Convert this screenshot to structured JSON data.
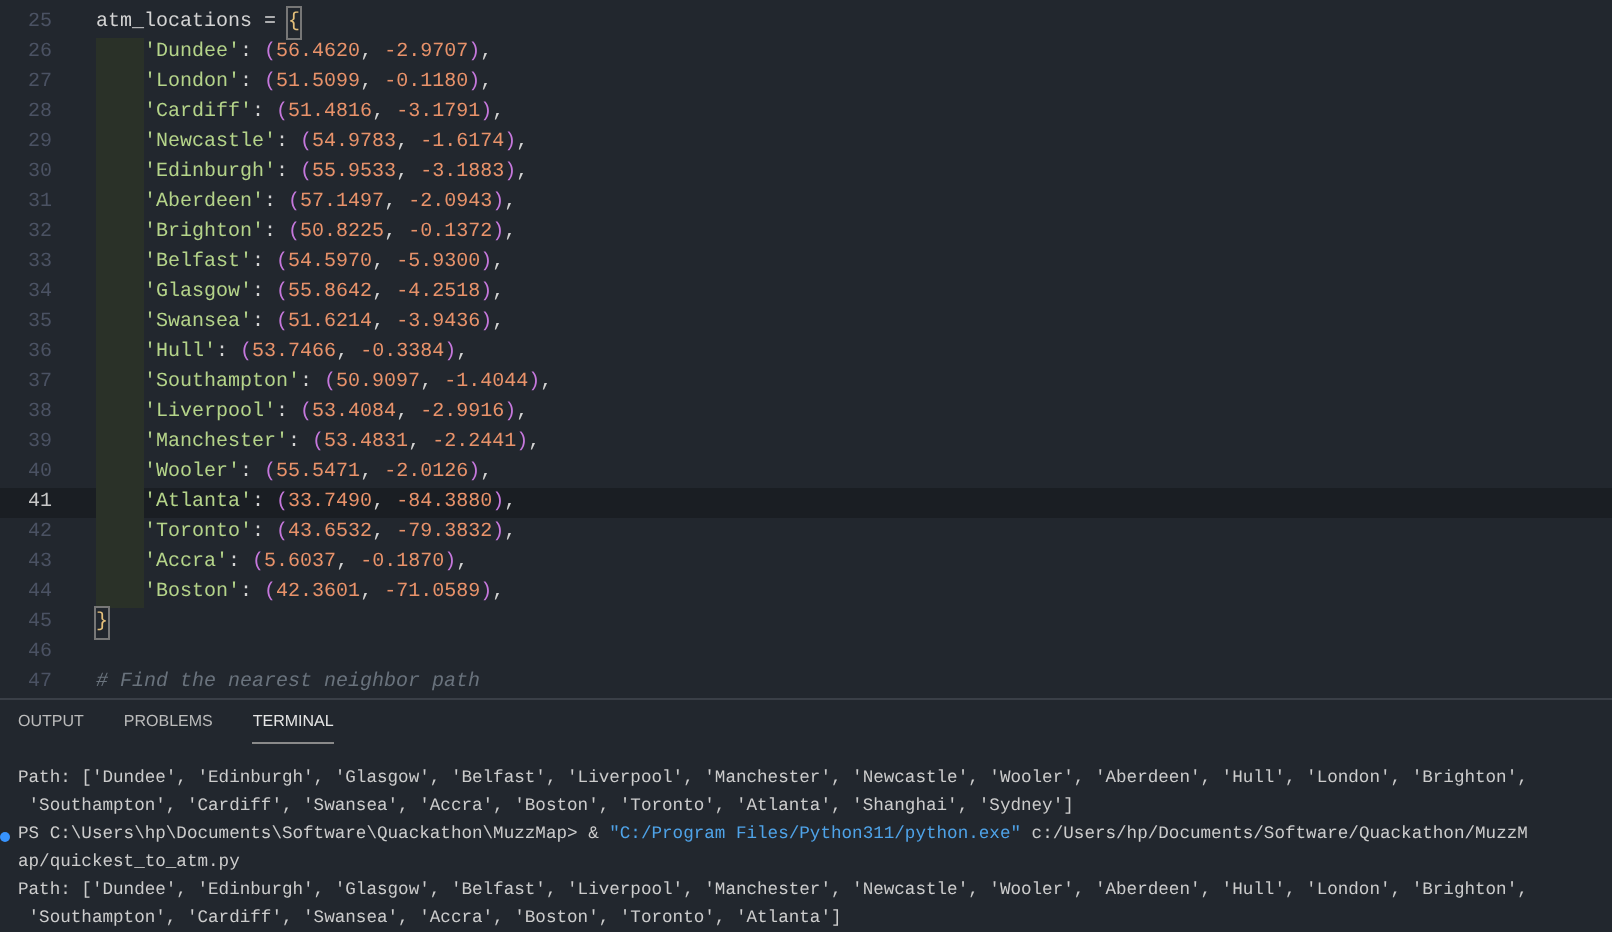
{
  "editor": {
    "lines": [
      {
        "number": "25",
        "kind": "code",
        "current": false,
        "tokens": [
          {
            "kind": "plain",
            "text": "atm_locations = "
          },
          {
            "kind": "brace",
            "text": "{"
          }
        ]
      },
      {
        "number": "26",
        "kind": "entry",
        "current": false,
        "tokens": [
          {
            "kind": "string",
            "text": "'Dundee'"
          },
          {
            "kind": "plain",
            "text": ": "
          },
          {
            "kind": "paren",
            "text": "("
          },
          {
            "kind": "number",
            "text": "56.4620"
          },
          {
            "kind": "plain",
            "text": ", "
          },
          {
            "kind": "number",
            "text": "-2.9707"
          },
          {
            "kind": "paren",
            "text": ")"
          },
          {
            "kind": "plain",
            "text": ","
          }
        ]
      },
      {
        "number": "27",
        "kind": "entry",
        "current": false,
        "tokens": [
          {
            "kind": "string",
            "text": "'London'"
          },
          {
            "kind": "plain",
            "text": ": "
          },
          {
            "kind": "paren",
            "text": "("
          },
          {
            "kind": "number",
            "text": "51.5099"
          },
          {
            "kind": "plain",
            "text": ", "
          },
          {
            "kind": "number",
            "text": "-0.1180"
          },
          {
            "kind": "paren",
            "text": ")"
          },
          {
            "kind": "plain",
            "text": ","
          }
        ]
      },
      {
        "number": "28",
        "kind": "entry",
        "current": false,
        "tokens": [
          {
            "kind": "string",
            "text": "'Cardiff'"
          },
          {
            "kind": "plain",
            "text": ": "
          },
          {
            "kind": "paren",
            "text": "("
          },
          {
            "kind": "number",
            "text": "51.4816"
          },
          {
            "kind": "plain",
            "text": ", "
          },
          {
            "kind": "number",
            "text": "-3.1791"
          },
          {
            "kind": "paren",
            "text": ")"
          },
          {
            "kind": "plain",
            "text": ","
          }
        ]
      },
      {
        "number": "29",
        "kind": "entry",
        "current": false,
        "tokens": [
          {
            "kind": "string",
            "text": "'Newcastle'"
          },
          {
            "kind": "plain",
            "text": ": "
          },
          {
            "kind": "paren",
            "text": "("
          },
          {
            "kind": "number",
            "text": "54.9783"
          },
          {
            "kind": "plain",
            "text": ", "
          },
          {
            "kind": "number",
            "text": "-1.6174"
          },
          {
            "kind": "paren",
            "text": ")"
          },
          {
            "kind": "plain",
            "text": ","
          }
        ]
      },
      {
        "number": "30",
        "kind": "entry",
        "current": false,
        "tokens": [
          {
            "kind": "string",
            "text": "'Edinburgh'"
          },
          {
            "kind": "plain",
            "text": ": "
          },
          {
            "kind": "paren",
            "text": "("
          },
          {
            "kind": "number",
            "text": "55.9533"
          },
          {
            "kind": "plain",
            "text": ", "
          },
          {
            "kind": "number",
            "text": "-3.1883"
          },
          {
            "kind": "paren",
            "text": ")"
          },
          {
            "kind": "plain",
            "text": ","
          }
        ]
      },
      {
        "number": "31",
        "kind": "entry",
        "current": false,
        "tokens": [
          {
            "kind": "string",
            "text": "'Aberdeen'"
          },
          {
            "kind": "plain",
            "text": ": "
          },
          {
            "kind": "paren",
            "text": "("
          },
          {
            "kind": "number",
            "text": "57.1497"
          },
          {
            "kind": "plain",
            "text": ", "
          },
          {
            "kind": "number",
            "text": "-2.0943"
          },
          {
            "kind": "paren",
            "text": ")"
          },
          {
            "kind": "plain",
            "text": ","
          }
        ]
      },
      {
        "number": "32",
        "kind": "entry",
        "current": false,
        "tokens": [
          {
            "kind": "string",
            "text": "'Brighton'"
          },
          {
            "kind": "plain",
            "text": ": "
          },
          {
            "kind": "paren",
            "text": "("
          },
          {
            "kind": "number",
            "text": "50.8225"
          },
          {
            "kind": "plain",
            "text": ", "
          },
          {
            "kind": "number",
            "text": "-0.1372"
          },
          {
            "kind": "paren",
            "text": ")"
          },
          {
            "kind": "plain",
            "text": ","
          }
        ]
      },
      {
        "number": "33",
        "kind": "entry",
        "current": false,
        "tokens": [
          {
            "kind": "string",
            "text": "'Belfast'"
          },
          {
            "kind": "plain",
            "text": ": "
          },
          {
            "kind": "paren",
            "text": "("
          },
          {
            "kind": "number",
            "text": "54.5970"
          },
          {
            "kind": "plain",
            "text": ", "
          },
          {
            "kind": "number",
            "text": "-5.9300"
          },
          {
            "kind": "paren",
            "text": ")"
          },
          {
            "kind": "plain",
            "text": ","
          }
        ]
      },
      {
        "number": "34",
        "kind": "entry",
        "current": false,
        "tokens": [
          {
            "kind": "string",
            "text": "'Glasgow'"
          },
          {
            "kind": "plain",
            "text": ": "
          },
          {
            "kind": "paren",
            "text": "("
          },
          {
            "kind": "number",
            "text": "55.8642"
          },
          {
            "kind": "plain",
            "text": ", "
          },
          {
            "kind": "number",
            "text": "-4.2518"
          },
          {
            "kind": "paren",
            "text": ")"
          },
          {
            "kind": "plain",
            "text": ","
          }
        ]
      },
      {
        "number": "35",
        "kind": "entry",
        "current": false,
        "tokens": [
          {
            "kind": "string",
            "text": "'Swansea'"
          },
          {
            "kind": "plain",
            "text": ": "
          },
          {
            "kind": "paren",
            "text": "("
          },
          {
            "kind": "number",
            "text": "51.6214"
          },
          {
            "kind": "plain",
            "text": ", "
          },
          {
            "kind": "number",
            "text": "-3.9436"
          },
          {
            "kind": "paren",
            "text": ")"
          },
          {
            "kind": "plain",
            "text": ","
          }
        ]
      },
      {
        "number": "36",
        "kind": "entry",
        "current": false,
        "tokens": [
          {
            "kind": "string",
            "text": "'Hull'"
          },
          {
            "kind": "plain",
            "text": ": "
          },
          {
            "kind": "paren",
            "text": "("
          },
          {
            "kind": "number",
            "text": "53.7466"
          },
          {
            "kind": "plain",
            "text": ", "
          },
          {
            "kind": "number",
            "text": "-0.3384"
          },
          {
            "kind": "paren",
            "text": ")"
          },
          {
            "kind": "plain",
            "text": ","
          }
        ]
      },
      {
        "number": "37",
        "kind": "entry",
        "current": false,
        "tokens": [
          {
            "kind": "string",
            "text": "'Southampton'"
          },
          {
            "kind": "plain",
            "text": ": "
          },
          {
            "kind": "paren",
            "text": "("
          },
          {
            "kind": "number",
            "text": "50.9097"
          },
          {
            "kind": "plain",
            "text": ", "
          },
          {
            "kind": "number",
            "text": "-1.4044"
          },
          {
            "kind": "paren",
            "text": ")"
          },
          {
            "kind": "plain",
            "text": ","
          }
        ]
      },
      {
        "number": "38",
        "kind": "entry",
        "current": false,
        "tokens": [
          {
            "kind": "string",
            "text": "'Liverpool'"
          },
          {
            "kind": "plain",
            "text": ": "
          },
          {
            "kind": "paren",
            "text": "("
          },
          {
            "kind": "number",
            "text": "53.4084"
          },
          {
            "kind": "plain",
            "text": ", "
          },
          {
            "kind": "number",
            "text": "-2.9916"
          },
          {
            "kind": "paren",
            "text": ")"
          },
          {
            "kind": "plain",
            "text": ","
          }
        ]
      },
      {
        "number": "39",
        "kind": "entry",
        "current": false,
        "tokens": [
          {
            "kind": "string",
            "text": "'Manchester'"
          },
          {
            "kind": "plain",
            "text": ": "
          },
          {
            "kind": "paren",
            "text": "("
          },
          {
            "kind": "number",
            "text": "53.4831"
          },
          {
            "kind": "plain",
            "text": ", "
          },
          {
            "kind": "number",
            "text": "-2.2441"
          },
          {
            "kind": "paren",
            "text": ")"
          },
          {
            "kind": "plain",
            "text": ","
          }
        ]
      },
      {
        "number": "40",
        "kind": "entry",
        "current": false,
        "tokens": [
          {
            "kind": "string",
            "text": "'Wooler'"
          },
          {
            "kind": "plain",
            "text": ": "
          },
          {
            "kind": "paren",
            "text": "("
          },
          {
            "kind": "number",
            "text": "55.5471"
          },
          {
            "kind": "plain",
            "text": ", "
          },
          {
            "kind": "number",
            "text": "-2.0126"
          },
          {
            "kind": "paren",
            "text": ")"
          },
          {
            "kind": "plain",
            "text": ","
          }
        ]
      },
      {
        "number": "41",
        "kind": "entry",
        "current": true,
        "tokens": [
          {
            "kind": "string",
            "text": "'Atlanta'"
          },
          {
            "kind": "plain",
            "text": ": "
          },
          {
            "kind": "paren",
            "text": "("
          },
          {
            "kind": "number",
            "text": "33.7490"
          },
          {
            "kind": "plain",
            "text": ", "
          },
          {
            "kind": "number",
            "text": "-84.3880"
          },
          {
            "kind": "paren",
            "text": ")"
          },
          {
            "kind": "plain",
            "text": ","
          }
        ]
      },
      {
        "number": "42",
        "kind": "entry",
        "current": false,
        "tokens": [
          {
            "kind": "string",
            "text": "'Toronto'"
          },
          {
            "kind": "plain",
            "text": ": "
          },
          {
            "kind": "paren",
            "text": "("
          },
          {
            "kind": "number",
            "text": "43.6532"
          },
          {
            "kind": "plain",
            "text": ", "
          },
          {
            "kind": "number",
            "text": "-79.3832"
          },
          {
            "kind": "paren",
            "text": ")"
          },
          {
            "kind": "plain",
            "text": ","
          }
        ]
      },
      {
        "number": "43",
        "kind": "entry",
        "current": false,
        "tokens": [
          {
            "kind": "string",
            "text": "'Accra'"
          },
          {
            "kind": "plain",
            "text": ": "
          },
          {
            "kind": "paren",
            "text": "("
          },
          {
            "kind": "number",
            "text": "5.6037"
          },
          {
            "kind": "plain",
            "text": ", "
          },
          {
            "kind": "number",
            "text": "-0.1870"
          },
          {
            "kind": "paren",
            "text": ")"
          },
          {
            "kind": "plain",
            "text": ","
          }
        ]
      },
      {
        "number": "44",
        "kind": "entry",
        "current": false,
        "tokens": [
          {
            "kind": "string",
            "text": "'Boston'"
          },
          {
            "kind": "plain",
            "text": ": "
          },
          {
            "kind": "paren",
            "text": "("
          },
          {
            "kind": "number",
            "text": "42.3601"
          },
          {
            "kind": "plain",
            "text": ", "
          },
          {
            "kind": "number",
            "text": "-71.0589"
          },
          {
            "kind": "paren",
            "text": ")"
          },
          {
            "kind": "plain",
            "text": ","
          }
        ]
      },
      {
        "number": "45",
        "kind": "code",
        "current": false,
        "tokens": [
          {
            "kind": "brace",
            "text": "}"
          }
        ]
      },
      {
        "number": "46",
        "kind": "code",
        "current": false
      },
      {
        "number": "47",
        "kind": "code",
        "current": false,
        "tokens": [
          {
            "kind": "comment",
            "text": "# Find the nearest neighbor path"
          }
        ]
      }
    ]
  },
  "panel": {
    "tabs": [
      {
        "label": "OUTPUT",
        "selected": false
      },
      {
        "label": "PROBLEMS",
        "selected": false
      },
      {
        "label": "TERMINAL",
        "selected": true
      }
    ],
    "terminal": [
      {
        "kind": "output",
        "text": "Path: ['Dundee', 'Edinburgh', 'Glasgow', 'Belfast', 'Liverpool', 'Manchester', 'Newcastle', 'Wooler', 'Aberdeen', 'Hull', 'London', 'Brighton',"
      },
      {
        "kind": "output",
        "text": " 'Southampton', 'Cardiff', 'Swansea', 'Accra', 'Boston', 'Toronto', 'Atlanta', 'Shanghai', 'Sydney']"
      },
      {
        "kind": "command",
        "prompt": "PS C:\\Users\\hp\\Documents\\Software\\Quackathon\\MuzzMap> & ",
        "exe": "\"C:/Program Files/Python311/python.exe\"",
        "args": " c:/Users/hp/Documents/Software/Quackathon/MuzzM"
      },
      {
        "kind": "output",
        "text": "ap/quickest_to_atm.py"
      },
      {
        "kind": "output",
        "text": "Path: ['Dundee', 'Edinburgh', 'Glasgow', 'Belfast', 'Liverpool', 'Manchester', 'Newcastle', 'Wooler', 'Aberdeen', 'Hull', 'London', 'Brighton',"
      },
      {
        "kind": "output",
        "text": " 'Southampton', 'Cardiff', 'Swansea', 'Accra', 'Boston', 'Toronto', 'Atlanta']"
      }
    ]
  }
}
